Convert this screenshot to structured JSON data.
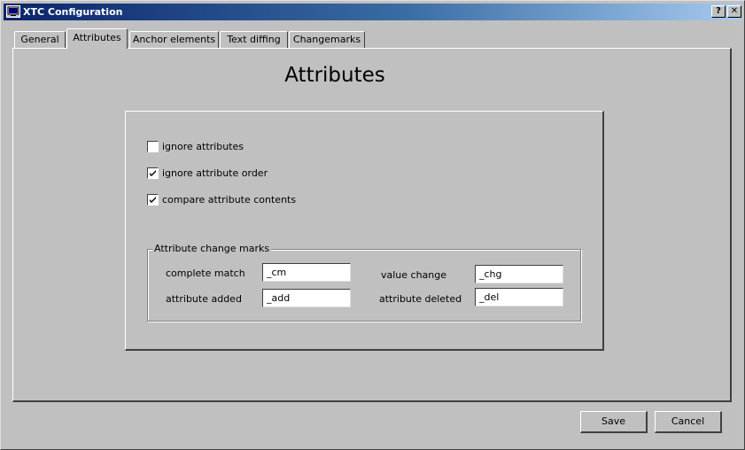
{
  "window": {
    "title": "XTC Configuration",
    "help_label": "?",
    "close_label": "✕"
  },
  "tabs": [
    {
      "label": "General",
      "active": false
    },
    {
      "label": "Attributes",
      "active": true
    },
    {
      "label": "Anchor elements",
      "active": false
    },
    {
      "label": "Text diffing",
      "active": false
    },
    {
      "label": "Changemarks",
      "active": false
    }
  ],
  "page": {
    "heading": "Attributes"
  },
  "options": [
    {
      "label": "ignore attributes",
      "checked": false
    },
    {
      "label": "ignore attribute order",
      "checked": true
    },
    {
      "label": "compare attribute contents",
      "checked": true
    }
  ],
  "change_marks": {
    "legend": "Attribute change marks",
    "complete_match": {
      "label": "complete match",
      "value": "_cm"
    },
    "value_change": {
      "label": "value change",
      "value": "_chg"
    },
    "attribute_added": {
      "label": "attribute added",
      "value": "_add"
    },
    "attribute_deleted": {
      "label": "attribute deleted",
      "value": "_del"
    }
  },
  "buttons": {
    "save": "Save",
    "cancel": "Cancel"
  }
}
